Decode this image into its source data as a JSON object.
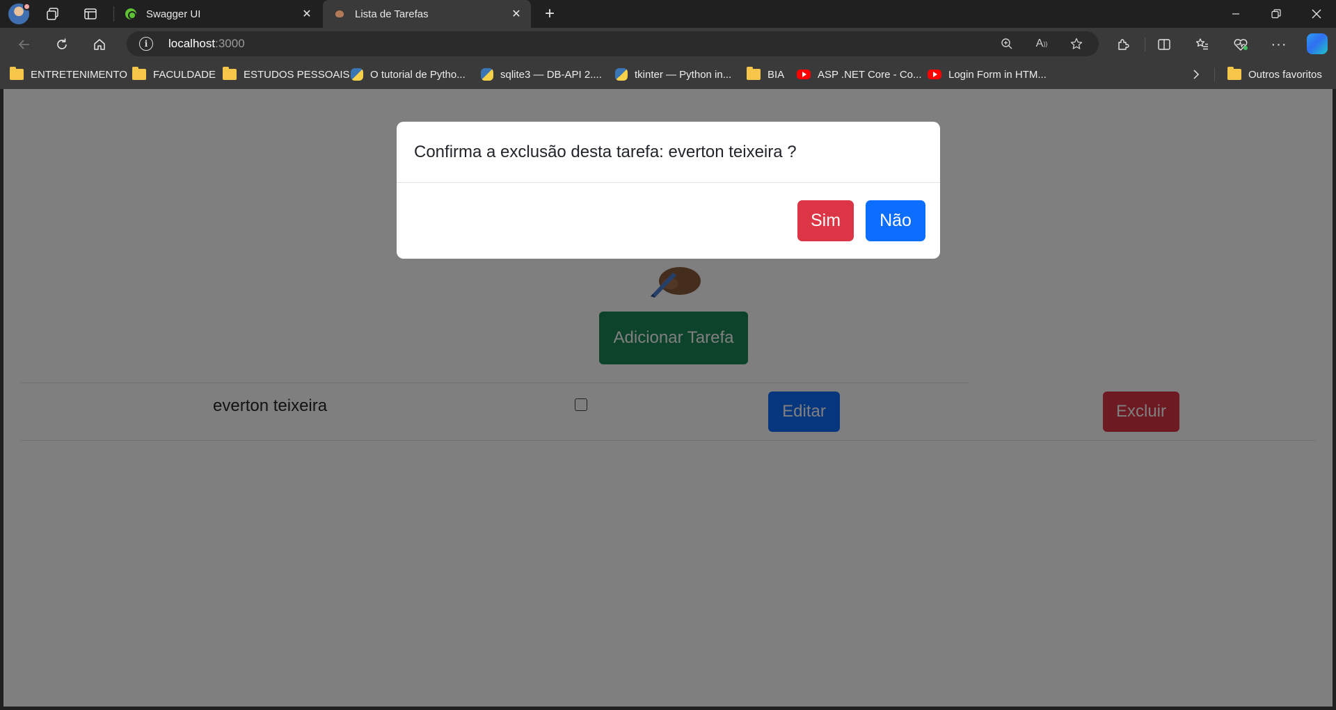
{
  "browser": {
    "tabs": [
      {
        "label": "Swagger UI",
        "active": false,
        "favicon": "swagger-icon"
      },
      {
        "label": "Lista de Tarefas",
        "active": true,
        "favicon": "app-icon"
      }
    ],
    "url": {
      "host": "localhost",
      "port": ":3000"
    },
    "bookmarks": [
      {
        "label": "ENTRETENIMENTO",
        "icon": "folder-icon"
      },
      {
        "label": "FACULDADE",
        "icon": "folder-icon"
      },
      {
        "label": "ESTUDOS PESSOAIS",
        "icon": "folder-icon"
      },
      {
        "label": "O tutorial de Pytho...",
        "icon": "python-icon"
      },
      {
        "label": "sqlite3 — DB-API 2....",
        "icon": "python-icon"
      },
      {
        "label": "tkinter — Python in...",
        "icon": "python-icon"
      },
      {
        "label": "BIA",
        "icon": "folder-icon"
      },
      {
        "label": "ASP .NET Core - Co...",
        "icon": "youtube-icon"
      },
      {
        "label": "Login Form in HTM...",
        "icon": "youtube-icon"
      }
    ],
    "other_favorites": "Outros favoritos"
  },
  "page": {
    "add_button": "Adicionar Tarefa",
    "tasks": [
      {
        "name": "everton teixeira",
        "done": false,
        "edit_label": "Editar",
        "delete_label": "Excluir"
      }
    ]
  },
  "modal": {
    "title": "Confirma a exclusão desta tarefa: everton teixeira ?",
    "yes_label": "Sim",
    "no_label": "Não"
  },
  "colors": {
    "success": "#198754",
    "primary": "#0d6efd",
    "danger": "#dc3545",
    "backdrop": "rgba(0,0,0,0.5)"
  }
}
